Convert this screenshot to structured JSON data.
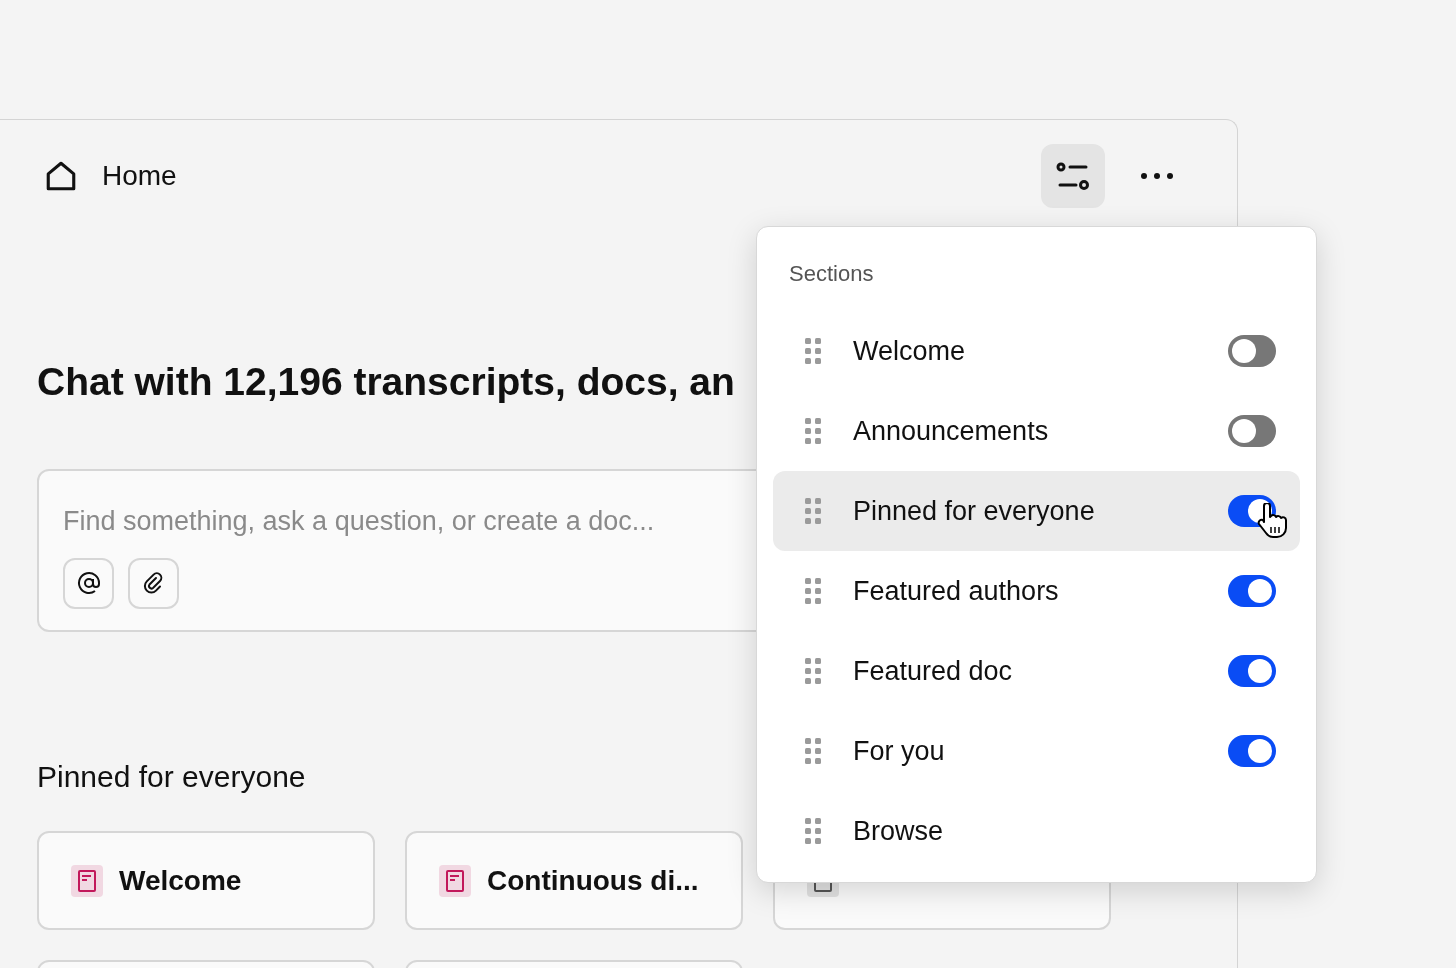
{
  "header": {
    "title": "Home"
  },
  "heading": "Chat with 12,196 transcripts, docs, an",
  "composer": {
    "placeholder": "Find something, ask a question, or create a doc..."
  },
  "pinned": {
    "title": "Pinned for everyone",
    "cards": [
      {
        "title": "Welcome",
        "kind": "doc"
      },
      {
        "title": "Continuous di...",
        "kind": "doc"
      },
      {
        "kind": "covered"
      }
    ]
  },
  "sections_menu": {
    "title": "Sections",
    "items": [
      {
        "label": "Welcome",
        "kind": "toggle",
        "on": false,
        "selected": false
      },
      {
        "label": "Announcements",
        "kind": "toggle",
        "on": false,
        "selected": false
      },
      {
        "label": "Pinned for everyone",
        "kind": "toggle",
        "on": true,
        "selected": true
      },
      {
        "label": "Featured authors",
        "kind": "toggle",
        "on": true,
        "selected": false
      },
      {
        "label": "Featured doc",
        "kind": "toggle",
        "on": true,
        "selected": false
      },
      {
        "label": "For you",
        "kind": "toggle",
        "on": true,
        "selected": false
      },
      {
        "label": "Browse",
        "kind": "plain",
        "selected": false
      }
    ]
  }
}
